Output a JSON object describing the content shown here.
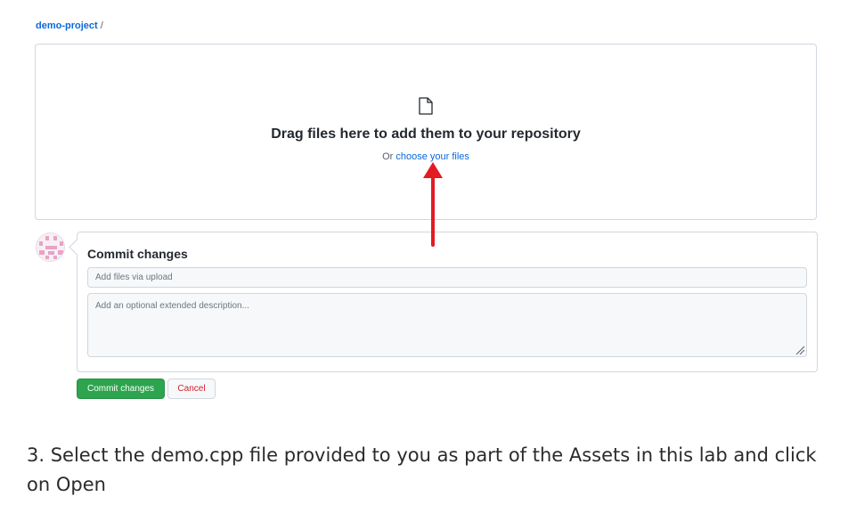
{
  "breadcrumb": {
    "repo": "demo-project",
    "separator": "/"
  },
  "dropzone": {
    "icon": "file-icon",
    "title": "Drag files here to add them to your repository",
    "prefix": "Or",
    "link": "choose your files"
  },
  "annotation": {
    "icon": "red-arrow-icon",
    "color": "#e31b23"
  },
  "commit": {
    "title": "Commit changes",
    "summary_placeholder": "Add files via upload",
    "summary_value": "",
    "description_placeholder": "Add an optional extended description...",
    "description_value": "",
    "commit_button": "Commit changes",
    "cancel_button": "Cancel"
  },
  "colors": {
    "accent": "#0969da",
    "commit_green": "#2da44e",
    "cancel_red": "#cf222e"
  },
  "instruction": "3. Select the demo.cpp file provided to you as part of the Assets in this lab and click on Open"
}
